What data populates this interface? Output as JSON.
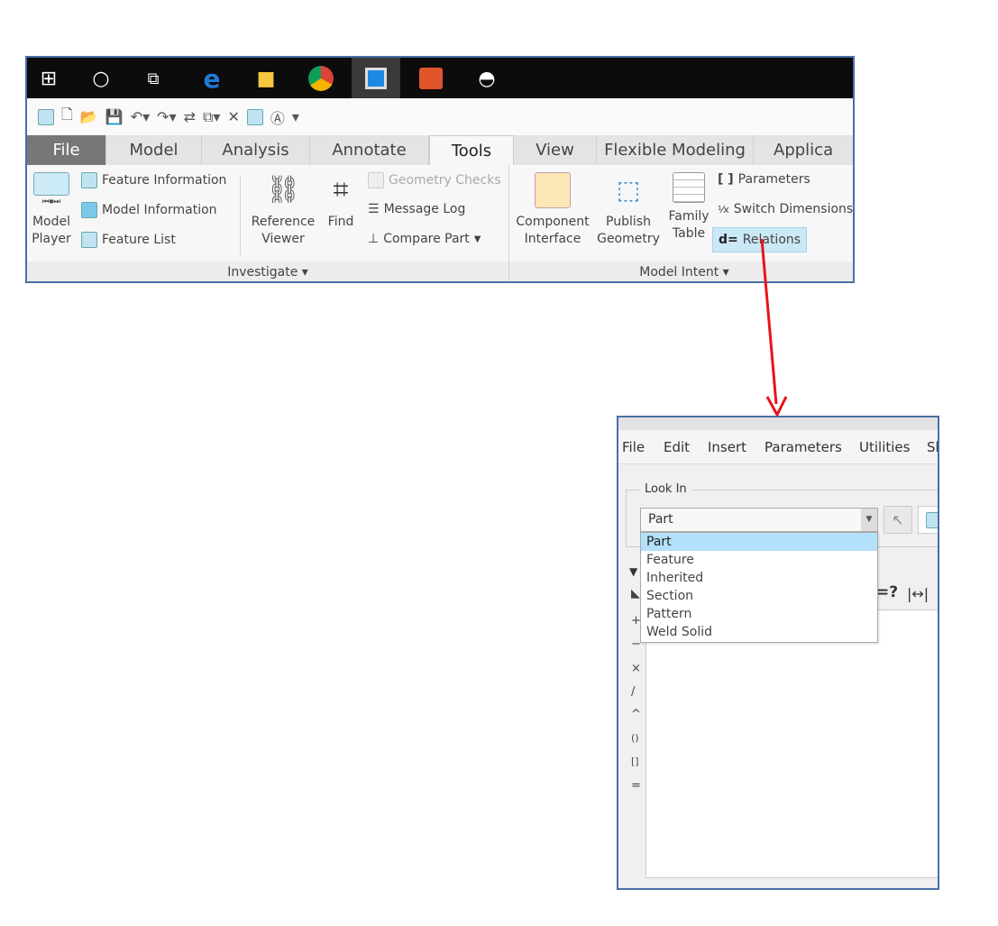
{
  "taskbar": {
    "icons": [
      "windows-start-icon",
      "cortana-icon",
      "task-view-icon",
      "edge-icon",
      "file-explorer-icon",
      "chrome-icon",
      "creo-icon",
      "powerpoint-icon",
      "photos-icon"
    ]
  },
  "tabs": [
    "File",
    "Model",
    "Analysis",
    "Annotate",
    "Tools",
    "View",
    "Flexible Modeling",
    "Applica"
  ],
  "active_tab": "Tools",
  "investigate": {
    "model_player": [
      "Model",
      "Player"
    ],
    "feature_information": "Feature Information",
    "model_information": "Model Information",
    "feature_list": "Feature List",
    "reference_viewer": [
      "Reference",
      "Viewer"
    ],
    "find": "Find",
    "geometry_checks": "Geometry Checks",
    "message_log": "Message Log",
    "compare_part": "Compare Part",
    "group_label": "Investigate ▾"
  },
  "model_intent": {
    "component_interface": [
      "Component",
      "Interface"
    ],
    "publish_geometry": [
      "Publish",
      "Geometry"
    ],
    "family_table": [
      "Family",
      "Table"
    ],
    "parameters": "Parameters",
    "switch_dimensions": "Switch Dimensions",
    "relations": "Relations",
    "relations_prefix": "d=",
    "group_label": "Model Intent ▾"
  },
  "dialog": {
    "menu": [
      "File",
      "Edit",
      "Insert",
      "Parameters",
      "Utilities",
      "Sh"
    ],
    "look_in_label": "Look In",
    "look_in_value": "Part",
    "options": [
      "Part",
      "Feature",
      "Inherited",
      "Section",
      "Pattern",
      "Weld Solid"
    ],
    "operators": [
      "+",
      "−",
      "×",
      "/",
      "^",
      "()",
      "[]",
      "="
    ],
    "toolbar_partial": "=?"
  },
  "colors": {
    "accent": "#b3e0fa",
    "arrow": "#e8141b",
    "border": "#4a6fa5"
  }
}
